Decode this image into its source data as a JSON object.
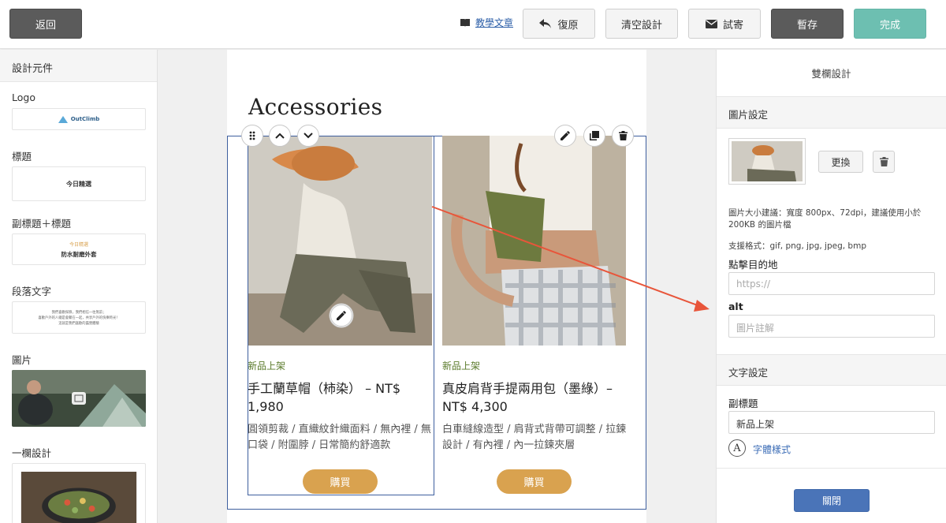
{
  "topbar": {
    "back": "返回",
    "tutorial": "教學文章",
    "restore": "復原",
    "clear": "清空設計",
    "test_send": "試寄",
    "save": "暫存",
    "done": "完成"
  },
  "left": {
    "header": "設計元件",
    "items": [
      {
        "label": "Logo",
        "preview": "OutClimb"
      },
      {
        "label": "標題",
        "preview": "今日精選"
      },
      {
        "label": "副標題＋標題",
        "preview_sub": "今日精選",
        "preview": "防水耐磨外套"
      },
      {
        "label": "段落文字",
        "preview_lines": [
          "我們喜歡探險，我們相信一往無前；",
          "喜歡戶外的人總是會聚在一起，共享戶外的快樂時光！",
          "這就是我們喜歡的露營體驗"
        ]
      },
      {
        "label": "圖片"
      },
      {
        "label": "一欄設計"
      }
    ]
  },
  "canvas": {
    "heading": "Accessories",
    "products": [
      {
        "tag": "新品上架",
        "title": "手工蘭草帽（柿染） – NT$ 1,980",
        "desc": "圓領剪裁 / 直織紋針織面料 / 無內裡 / 無口袋 / 附圍脖 / 日常簡約舒適款",
        "buy": "購買"
      },
      {
        "tag": "新品上架",
        "title": "真皮肩背手提兩用包（墨綠）– NT$ 4,300",
        "desc": "白車縫線造型 / 肩背式背帶可調整 / 拉鍊設計 / 有內裡 / 內一拉鍊夾層",
        "buy": "購買"
      }
    ]
  },
  "right": {
    "title": "雙欄設計",
    "image_section": "圖片設定",
    "replace": "更換",
    "size_hint": "圖片大小建議：寬度 800px、72dpi，建議使用小於 200KB 的圖片檔",
    "formats": "支援格式：gif, png, jpg, jpeg, bmp",
    "link_label": "點擊目的地",
    "link_placeholder": "https://",
    "alt_label": "alt",
    "alt_placeholder": "圖片註解",
    "text_section": "文字設定",
    "subtitle_label": "副標題",
    "subtitle_value": "新品上架",
    "font_style": "字體樣式",
    "font_icon_letter": "A",
    "close": "關閉"
  },
  "colors": {
    "accent_blue": "#3e5f9e",
    "buy_orange": "#d9a24f",
    "done_teal": "#6dbfb1",
    "close_blue": "#4a74b8",
    "tag_green": "#5a7a2a",
    "arrow_red": "#e8553a"
  }
}
